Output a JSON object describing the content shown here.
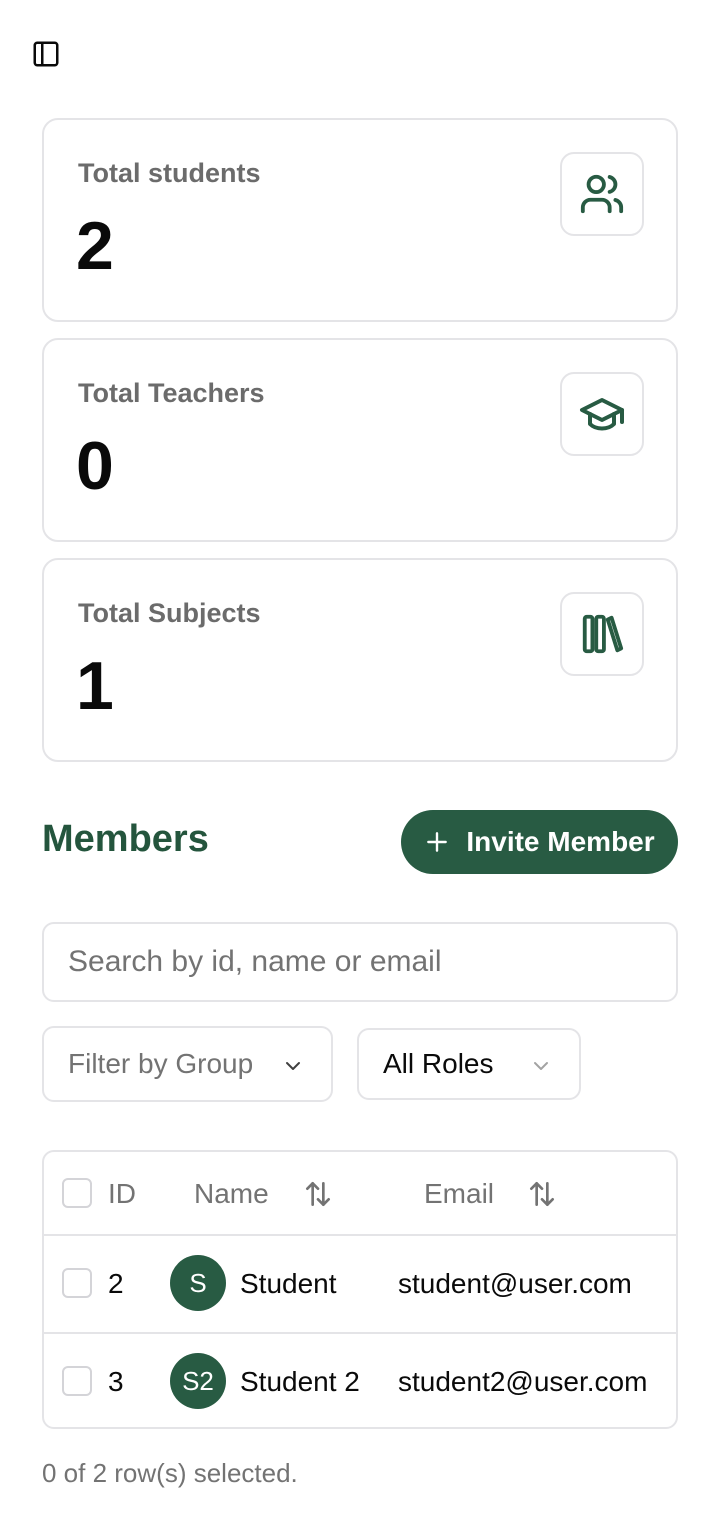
{
  "header": {
    "sidebar_toggle_icon": "panel-left-icon"
  },
  "stats": [
    {
      "label": "Total students",
      "value": "2",
      "icon": "users-icon"
    },
    {
      "label": "Total Teachers",
      "value": "0",
      "icon": "graduation-cap-icon"
    },
    {
      "label": "Total Subjects",
      "value": "1",
      "icon": "library-icon"
    }
  ],
  "members": {
    "title": "Members",
    "invite_label": "Invite Member",
    "search_placeholder": "Search by id, name or email",
    "filter_group": "Filter by Group",
    "role_filter": "All Roles",
    "columns": {
      "id": "ID",
      "name": "Name",
      "email": "Email"
    },
    "rows": [
      {
        "id": "2",
        "initials": "S",
        "name": "Student",
        "email": "student@user.com"
      },
      {
        "id": "3",
        "initials": "S2",
        "name": "Student 2",
        "email": "student2@user.com"
      }
    ],
    "selection_status": "0 of 2 row(s) selected."
  },
  "colors": {
    "accent": "#285b43",
    "border": "#e4e4e7",
    "muted": "#737373"
  }
}
